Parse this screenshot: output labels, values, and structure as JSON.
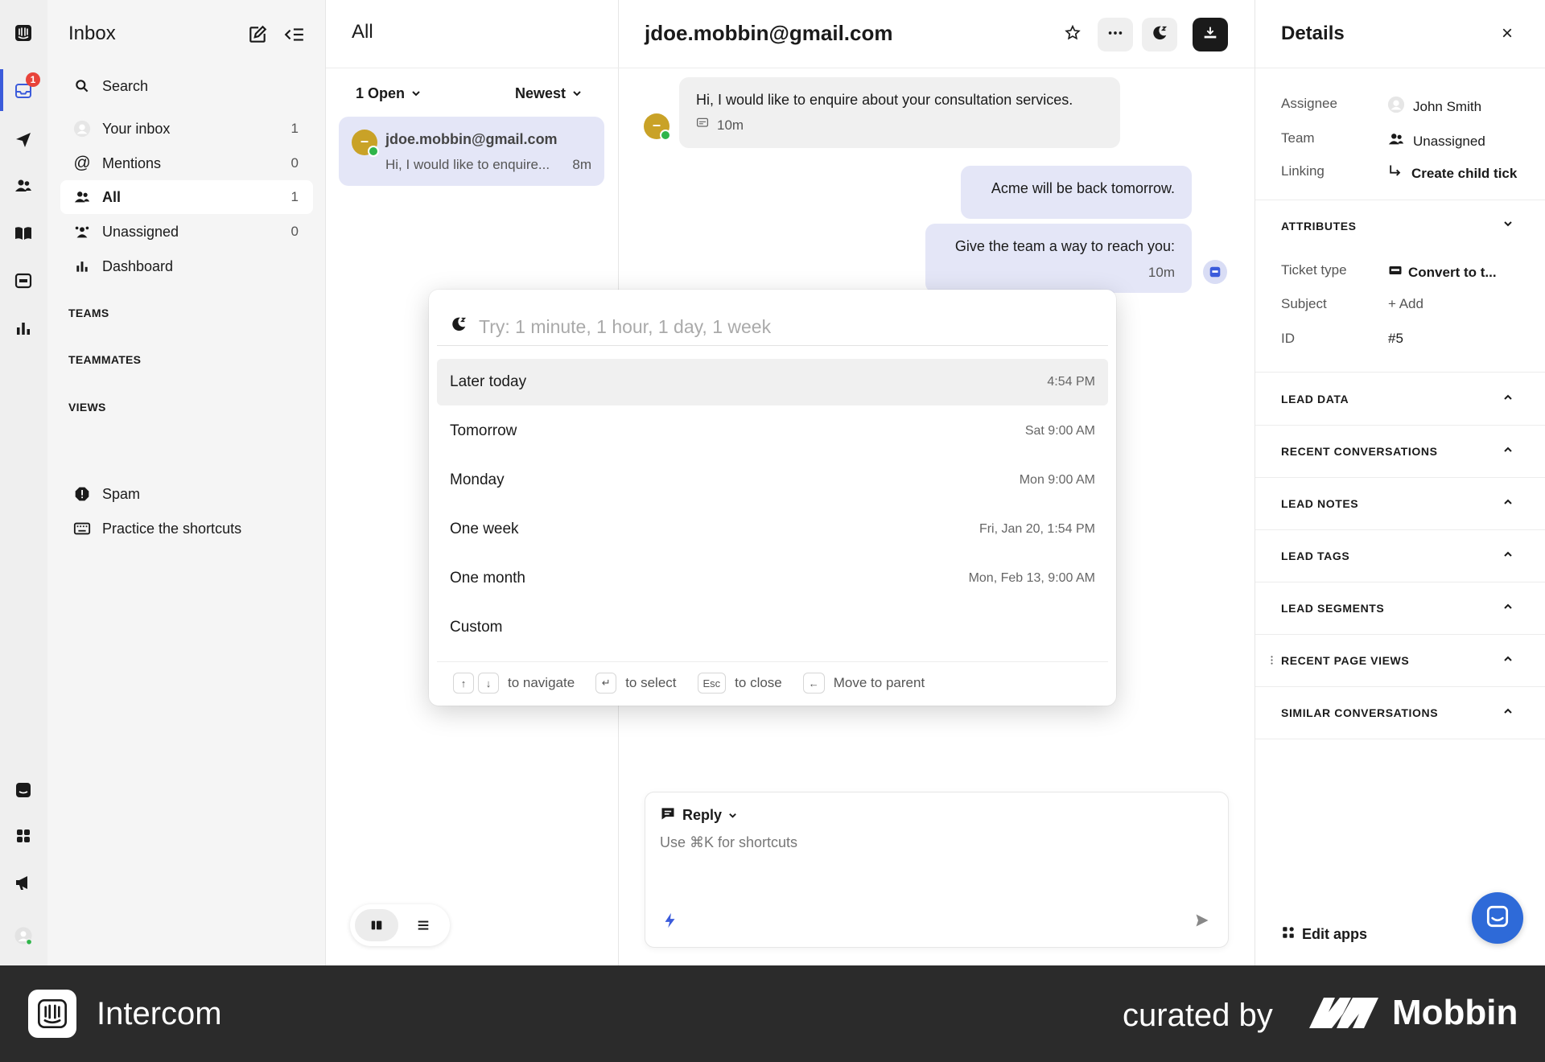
{
  "nav": {
    "title": "Inbox",
    "search": "Search",
    "items": [
      {
        "label": "Your inbox",
        "count": "1"
      },
      {
        "label": "Mentions",
        "count": "0"
      },
      {
        "label": "All",
        "count": "1"
      },
      {
        "label": "Unassigned",
        "count": "0"
      },
      {
        "label": "Dashboard",
        "count": ""
      }
    ],
    "sections": [
      "TEAMS",
      "TEAMMATES",
      "VIEWS"
    ],
    "spam": "Spam",
    "shortcuts": "Practice the shortcuts",
    "inbox_badge": "1"
  },
  "list": {
    "title": "All",
    "filter_status": "1 Open",
    "filter_sort": "Newest",
    "conversation": {
      "email": "jdoe.mobbin@gmail.com",
      "preview": "Hi, I would like to enquire...",
      "time": "8m",
      "avatar_initial": "–"
    }
  },
  "conversation": {
    "title": "jdoe.mobbin@gmail.com",
    "messages": [
      {
        "text": "Hi, I would like to enquire about your consultation services.",
        "time": "10m"
      },
      {
        "text": "Acme will be back tomorrow."
      },
      {
        "text": "Give the team a way to reach you:",
        "time": "10m"
      }
    ],
    "composer": {
      "mode": "Reply",
      "placeholder": "Use ⌘K for shortcuts"
    }
  },
  "snooze": {
    "placeholder": "Try: 1 minute, 1 hour, 1 day, 1 week",
    "options": [
      {
        "label": "Later today",
        "when": "4:54 PM"
      },
      {
        "label": "Tomorrow",
        "when": "Sat 9:00 AM"
      },
      {
        "label": "Monday",
        "when": "Mon 9:00 AM"
      },
      {
        "label": "One week",
        "when": "Fri, Jan 20, 1:54 PM"
      },
      {
        "label": "One month",
        "when": "Mon, Feb 13, 9:00 AM"
      },
      {
        "label": "Custom",
        "when": ""
      }
    ],
    "footer": {
      "navigate": "to navigate",
      "select": "to select",
      "esc_key": "Esc",
      "close": "to close",
      "parent": "Move to parent"
    }
  },
  "details": {
    "title": "Details",
    "assignee_label": "Assignee",
    "assignee": "John Smith",
    "team_label": "Team",
    "team": "Unassigned",
    "linking_label": "Linking",
    "linking": "Create child tick",
    "attributes": "ATTRIBUTES",
    "ticket_type_label": "Ticket type",
    "ticket_type": "Convert to t...",
    "subject_label": "Subject",
    "subject": "+ Add",
    "id_label": "ID",
    "id": "#5",
    "sections": [
      "LEAD DATA",
      "RECENT CONVERSATIONS",
      "LEAD NOTES",
      "LEAD TAGS",
      "LEAD SEGMENTS",
      "RECENT PAGE VIEWS",
      "SIMILAR CONVERSATIONS"
    ],
    "edit_apps": "Edit apps"
  },
  "brand": {
    "app": "Intercom",
    "curated": "curated by",
    "mobbin": "Mobbin"
  },
  "colors": {
    "accent": "#3b5bdb",
    "selected_bg": "#e4e6f7",
    "badge": "#e8433a",
    "online": "#2fb54a",
    "messenger": "#2e6ad8"
  }
}
